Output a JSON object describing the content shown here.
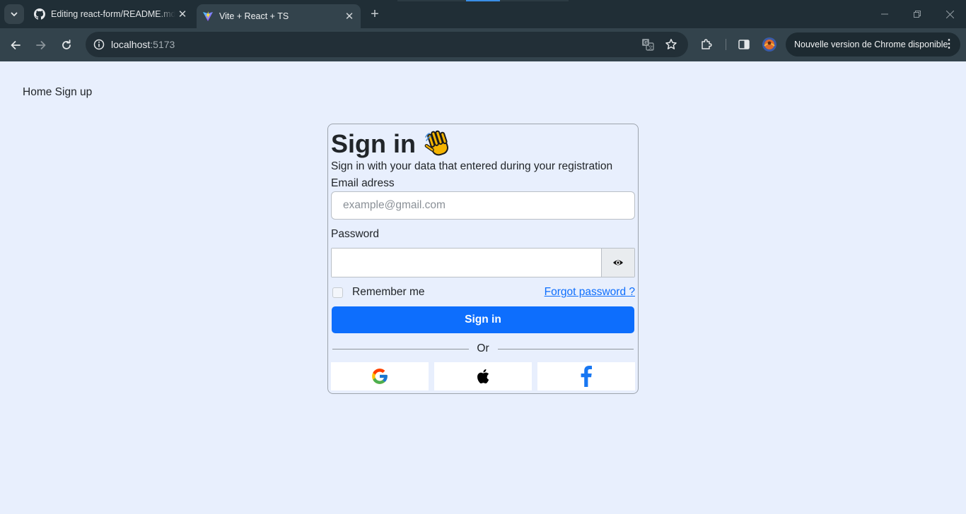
{
  "browser": {
    "tabs": [
      {
        "title": "Editing react-form/README.md",
        "icon": "github-icon"
      },
      {
        "title": "Vite + React + TS",
        "icon": "vite-icon",
        "active": true
      }
    ],
    "url_host": "localhost",
    "url_port": ":5173",
    "update_label": "Nouvelle version de Chrome disponible"
  },
  "nav": {
    "home": "Home",
    "signup": "Sign up"
  },
  "form": {
    "title": "Sign in",
    "title_emoji": "waving-hands",
    "subtitle": "Sign in with your data that entered during your registration",
    "email_label": "Email adress",
    "email_placeholder": "example@gmail.com",
    "email_value": "",
    "password_label": "Password",
    "password_value": "",
    "remember_label": "Remember me",
    "remember_checked": false,
    "forgot_label": "Forgot password ?",
    "submit_label": "Sign in",
    "divider_label": "Or",
    "social": [
      "google-icon",
      "apple-icon",
      "facebook-icon"
    ]
  },
  "colors": {
    "page_bg": "#e8effd",
    "primary": "#0d6efd",
    "tabbar_bg": "#202e36",
    "toolbar_bg": "#33434c"
  }
}
